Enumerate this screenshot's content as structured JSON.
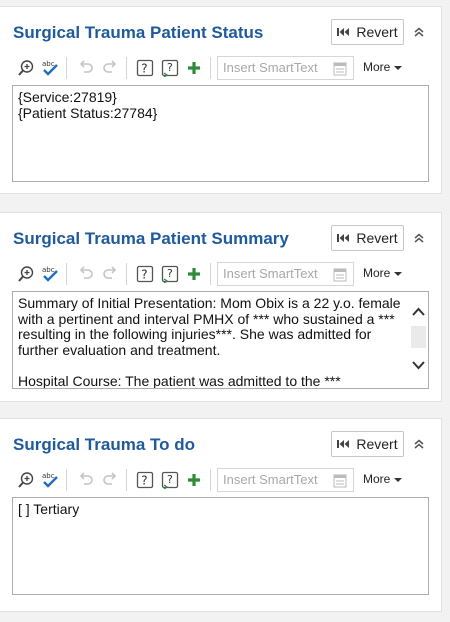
{
  "panels": [
    {
      "title": "Surgical Trauma Patient Status",
      "revert_label": "Revert",
      "smarttext_placeholder": "Insert SmartText",
      "more_label": "More",
      "content_lines": [
        "{Service:27819}",
        "{Patient Status:27784}"
      ]
    },
    {
      "title": "Surgical Trauma Patient Summary",
      "revert_label": "Revert",
      "smarttext_placeholder": "Insert SmartText",
      "more_label": "More",
      "content_para1": "Summary of Initial Presentation: Mom Obix is a 22 y.o. female with a pertinent and interval PMHX of *** who sustained a *** resulting in the following injuries***.  She was admitted for further evaluation and treatment.",
      "content_para2": "Hospital Course:  The patient was admitted to the ***"
    },
    {
      "title": "Surgical Trauma To do",
      "revert_label": "Revert",
      "smarttext_placeholder": "Insert SmartText",
      "more_label": "More",
      "content_lines": [
        "[ ] Tertiary"
      ]
    }
  ],
  "colors": {
    "title": "#1f5a9c",
    "plus_icon": "#2e8b3a",
    "spell_icon": "#1f6fc0"
  },
  "icons": [
    "zoom-in-icon",
    "spellcheck-icon",
    "undo-icon",
    "redo-icon",
    "help-field-icon",
    "next-field-icon",
    "add-icon",
    "smartphrase-list-icon",
    "chevron-down-icon",
    "revert-icon",
    "collapse-icon"
  ]
}
